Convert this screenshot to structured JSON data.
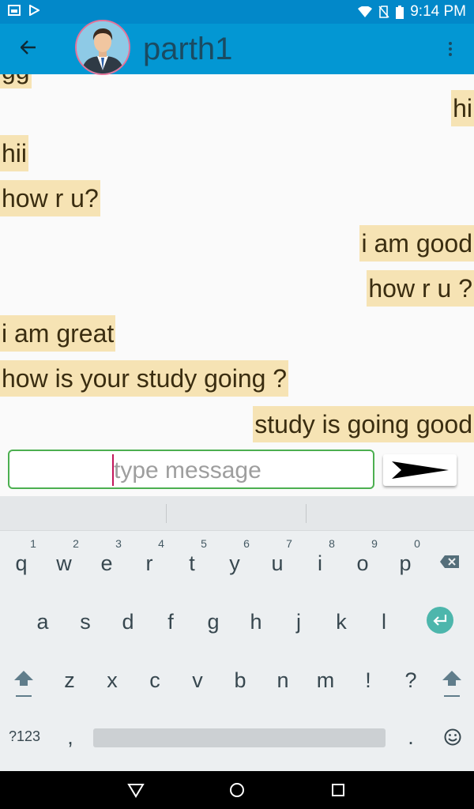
{
  "status": {
    "time": "9:14 PM"
  },
  "header": {
    "contact_name": "parth1",
    "back_icon": "arrow-left-icon",
    "menu_icon": "overflow-menu-icon"
  },
  "messages": [
    {
      "text": "gg",
      "dir": "in"
    },
    {
      "text": "hi",
      "dir": "out"
    },
    {
      "text": "hii",
      "dir": "in"
    },
    {
      "text": "how r u?",
      "dir": "in"
    },
    {
      "text": "i am good",
      "dir": "out"
    },
    {
      "text": "how r u ?",
      "dir": "out"
    },
    {
      "text": "i am great",
      "dir": "in"
    },
    {
      "text": "how is your study going ?",
      "dir": "in"
    },
    {
      "text": "study is going good",
      "dir": "out"
    }
  ],
  "composer": {
    "placeholder": "type message",
    "value": ""
  },
  "keyboard": {
    "row1": [
      {
        "l": "q",
        "n": "1"
      },
      {
        "l": "w",
        "n": "2"
      },
      {
        "l": "e",
        "n": "3"
      },
      {
        "l": "r",
        "n": "4"
      },
      {
        "l": "t",
        "n": "5"
      },
      {
        "l": "y",
        "n": "6"
      },
      {
        "l": "u",
        "n": "7"
      },
      {
        "l": "i",
        "n": "8"
      },
      {
        "l": "o",
        "n": "9"
      },
      {
        "l": "p",
        "n": "0"
      }
    ],
    "row2": [
      "a",
      "s",
      "d",
      "f",
      "g",
      "h",
      "j",
      "k",
      "l"
    ],
    "row3": [
      "z",
      "x",
      "c",
      "v",
      "b",
      "n",
      "m",
      "!",
      "?"
    ],
    "symbols_label": "?123",
    "comma": ",",
    "period": "."
  },
  "colors": {
    "appbar": "#0397d3",
    "bubble": "#f6e3b4",
    "enter_key": "#4db6ac",
    "input_border": "#4caf50"
  }
}
